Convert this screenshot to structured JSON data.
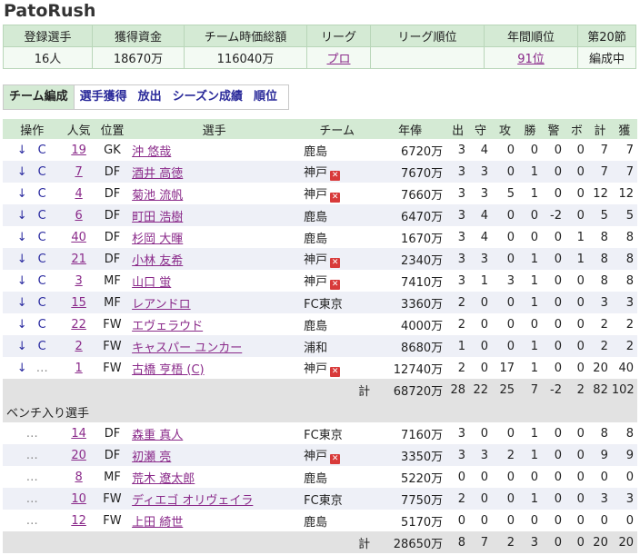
{
  "title": "PatoRush",
  "summary": {
    "headers": [
      "登録選手",
      "獲得資金",
      "チーム時価総額",
      "リーグ",
      "リーグ順位",
      "年間順位",
      "第20節"
    ],
    "values": [
      "16人",
      "18670万",
      "116040万",
      "プロ",
      "",
      "91位",
      "編成中"
    ]
  },
  "tabs": [
    "チーム編成",
    "選手獲得",
    "放出",
    "シーズン成績",
    "順位"
  ],
  "roster": {
    "headers": [
      "操作",
      "人気",
      "位置",
      "選手",
      "チーム",
      "年俸",
      "出",
      "守",
      "攻",
      "勝",
      "警",
      "ボ",
      "計",
      "獲"
    ],
    "starters": [
      {
        "ctrl1": "↓",
        "ctrl2": "C",
        "pop": "19",
        "pos": "GK",
        "name": "沖 悠哉",
        "team": "鹿島",
        "flag": false,
        "salary": "6720万",
        "s": [
          "3",
          "4",
          "0",
          "0",
          "0",
          "0",
          "7",
          "7"
        ]
      },
      {
        "ctrl1": "↓",
        "ctrl2": "C",
        "pop": "7",
        "pos": "DF",
        "name": "酒井 高徳",
        "team": "神戸",
        "flag": true,
        "salary": "7670万",
        "s": [
          "3",
          "3",
          "0",
          "1",
          "0",
          "0",
          "7",
          "7"
        ]
      },
      {
        "ctrl1": "↓",
        "ctrl2": "C",
        "pop": "4",
        "pos": "DF",
        "name": "菊池 流帆",
        "team": "神戸",
        "flag": true,
        "salary": "7660万",
        "s": [
          "3",
          "3",
          "5",
          "1",
          "0",
          "0",
          "12",
          "12"
        ]
      },
      {
        "ctrl1": "↓",
        "ctrl2": "C",
        "pop": "6",
        "pos": "DF",
        "name": "町田 浩樹",
        "team": "鹿島",
        "flag": false,
        "salary": "6470万",
        "s": [
          "3",
          "4",
          "0",
          "0",
          "-2",
          "0",
          "5",
          "5"
        ]
      },
      {
        "ctrl1": "↓",
        "ctrl2": "C",
        "pop": "40",
        "pos": "DF",
        "name": "杉岡 大暉",
        "team": "鹿島",
        "flag": false,
        "salary": "1670万",
        "s": [
          "3",
          "4",
          "0",
          "0",
          "0",
          "1",
          "8",
          "8"
        ]
      },
      {
        "ctrl1": "↓",
        "ctrl2": "C",
        "pop": "21",
        "pos": "DF",
        "name": "小林 友希",
        "team": "神戸",
        "flag": true,
        "salary": "2340万",
        "s": [
          "3",
          "3",
          "0",
          "1",
          "0",
          "1",
          "8",
          "8"
        ]
      },
      {
        "ctrl1": "↓",
        "ctrl2": "C",
        "pop": "3",
        "pos": "MF",
        "name": "山口 蛍",
        "team": "神戸",
        "flag": true,
        "salary": "7410万",
        "s": [
          "3",
          "1",
          "3",
          "1",
          "0",
          "0",
          "8",
          "8"
        ]
      },
      {
        "ctrl1": "↓",
        "ctrl2": "C",
        "pop": "15",
        "pos": "MF",
        "name": "レアンドロ",
        "team": "FC東京",
        "flag": false,
        "salary": "3360万",
        "s": [
          "2",
          "0",
          "0",
          "1",
          "0",
          "0",
          "3",
          "3"
        ]
      },
      {
        "ctrl1": "↓",
        "ctrl2": "C",
        "pop": "22",
        "pos": "FW",
        "name": "エヴェラウド",
        "team": "鹿島",
        "flag": false,
        "salary": "4000万",
        "s": [
          "2",
          "0",
          "0",
          "0",
          "0",
          "0",
          "2",
          "2"
        ]
      },
      {
        "ctrl1": "↓",
        "ctrl2": "C",
        "pop": "2",
        "pos": "FW",
        "name": "キャスパー ユンカー",
        "team": "浦和",
        "flag": false,
        "salary": "8680万",
        "s": [
          "1",
          "0",
          "0",
          "1",
          "0",
          "0",
          "2",
          "2"
        ]
      },
      {
        "ctrl1": "↓",
        "ctrl2": "…",
        "pop": "1",
        "pos": "FW",
        "name": "古橋 亨梧 (C)",
        "team": "神戸",
        "flag": true,
        "salary": "12740万",
        "s": [
          "2",
          "0",
          "17",
          "1",
          "0",
          "0",
          "20",
          "40"
        ]
      }
    ],
    "starters_total": {
      "label": "計",
      "salary": "68720万",
      "s": [
        "28",
        "22",
        "25",
        "7",
        "-2",
        "2",
        "82",
        "102"
      ]
    },
    "bench_label": "ベンチ入り選手",
    "bench": [
      {
        "ctrl1": "…",
        "ctrl2": "",
        "pop": "14",
        "pos": "DF",
        "name": "森重 真人",
        "team": "FC東京",
        "flag": false,
        "salary": "7160万",
        "s": [
          "3",
          "0",
          "0",
          "1",
          "0",
          "0",
          "8",
          "8"
        ]
      },
      {
        "ctrl1": "…",
        "ctrl2": "",
        "pop": "20",
        "pos": "DF",
        "name": "初瀬 亮",
        "team": "神戸",
        "flag": true,
        "salary": "3350万",
        "s": [
          "3",
          "3",
          "2",
          "1",
          "0",
          "0",
          "9",
          "9"
        ]
      },
      {
        "ctrl1": "…",
        "ctrl2": "",
        "pop": "8",
        "pos": "MF",
        "name": "荒木 遼太郎",
        "team": "鹿島",
        "flag": false,
        "salary": "5220万",
        "s": [
          "0",
          "0",
          "0",
          "0",
          "0",
          "0",
          "0",
          "0"
        ]
      },
      {
        "ctrl1": "…",
        "ctrl2": "",
        "pop": "10",
        "pos": "FW",
        "name": "ディエゴ オリヴェイラ",
        "team": "FC東京",
        "flag": false,
        "salary": "7750万",
        "s": [
          "2",
          "0",
          "0",
          "1",
          "0",
          "0",
          "3",
          "3"
        ]
      },
      {
        "ctrl1": "…",
        "ctrl2": "",
        "pop": "12",
        "pos": "FW",
        "name": "上田 綺世",
        "team": "鹿島",
        "flag": false,
        "salary": "5170万",
        "s": [
          "0",
          "0",
          "0",
          "0",
          "0",
          "0",
          "0",
          "0"
        ]
      }
    ],
    "bench_total": {
      "label": "計",
      "salary": "28650万",
      "s": [
        "8",
        "7",
        "2",
        "3",
        "0",
        "0",
        "20",
        "20"
      ]
    }
  },
  "colors": {
    "header_bg": "#d4ead4",
    "summary_bg": "#f3faf3",
    "link": "#8a2a8a",
    "ctrl": "#2a2aa0",
    "flag": "#d83a3a",
    "alt_row": "#eef0f7"
  },
  "icons": {
    "down": "down-arrow-icon",
    "captain": "captain-c-icon",
    "more": "ellipsis-icon",
    "flag": "close-x-icon"
  }
}
